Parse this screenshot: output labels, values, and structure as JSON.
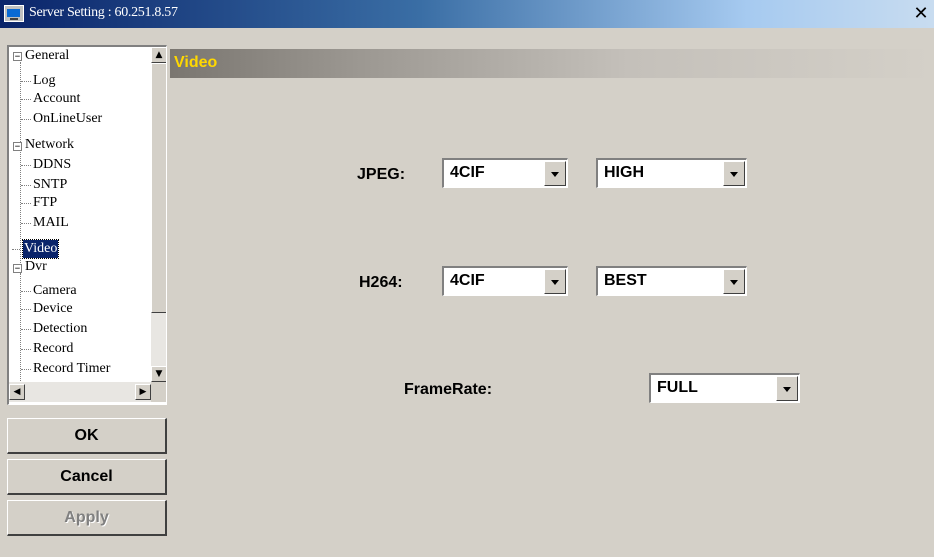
{
  "window": {
    "title": "Server Setting : 60.251.8.57",
    "close_glyph": "✕"
  },
  "tree": {
    "items": [
      {
        "label": "General",
        "expander": "−"
      },
      {
        "label": "Log"
      },
      {
        "label": "Account"
      },
      {
        "label": "OnLineUser"
      },
      {
        "label": "Network",
        "expander": "−"
      },
      {
        "label": "DDNS"
      },
      {
        "label": "SNTP"
      },
      {
        "label": "FTP"
      },
      {
        "label": "MAIL"
      },
      {
        "label": "Video",
        "selected": true
      },
      {
        "label": "Dvr",
        "expander": "−"
      },
      {
        "label": "Camera"
      },
      {
        "label": "Device"
      },
      {
        "label": "Detection"
      },
      {
        "label": "Record"
      },
      {
        "label": "Record Timer"
      }
    ],
    "scroll_icons": {
      "up": "▲",
      "down": "▼",
      "left": "◀",
      "right": "▶"
    }
  },
  "buttons": {
    "ok": "OK",
    "cancel": "Cancel",
    "apply": "Apply"
  },
  "panel": {
    "title": "Video",
    "jpeg": {
      "label": "JPEG:",
      "resolution": "4CIF",
      "quality": "HIGH"
    },
    "h264": {
      "label": "H264:",
      "resolution": "4CIF",
      "quality": "BEST"
    },
    "framerate": {
      "label": "FrameRate:",
      "value": "FULL"
    }
  },
  "colors": {
    "title_bar": "#0a246a",
    "header_text": "#ffd800",
    "selection": "#0a246a",
    "window_bg": "#d4d0c8"
  }
}
